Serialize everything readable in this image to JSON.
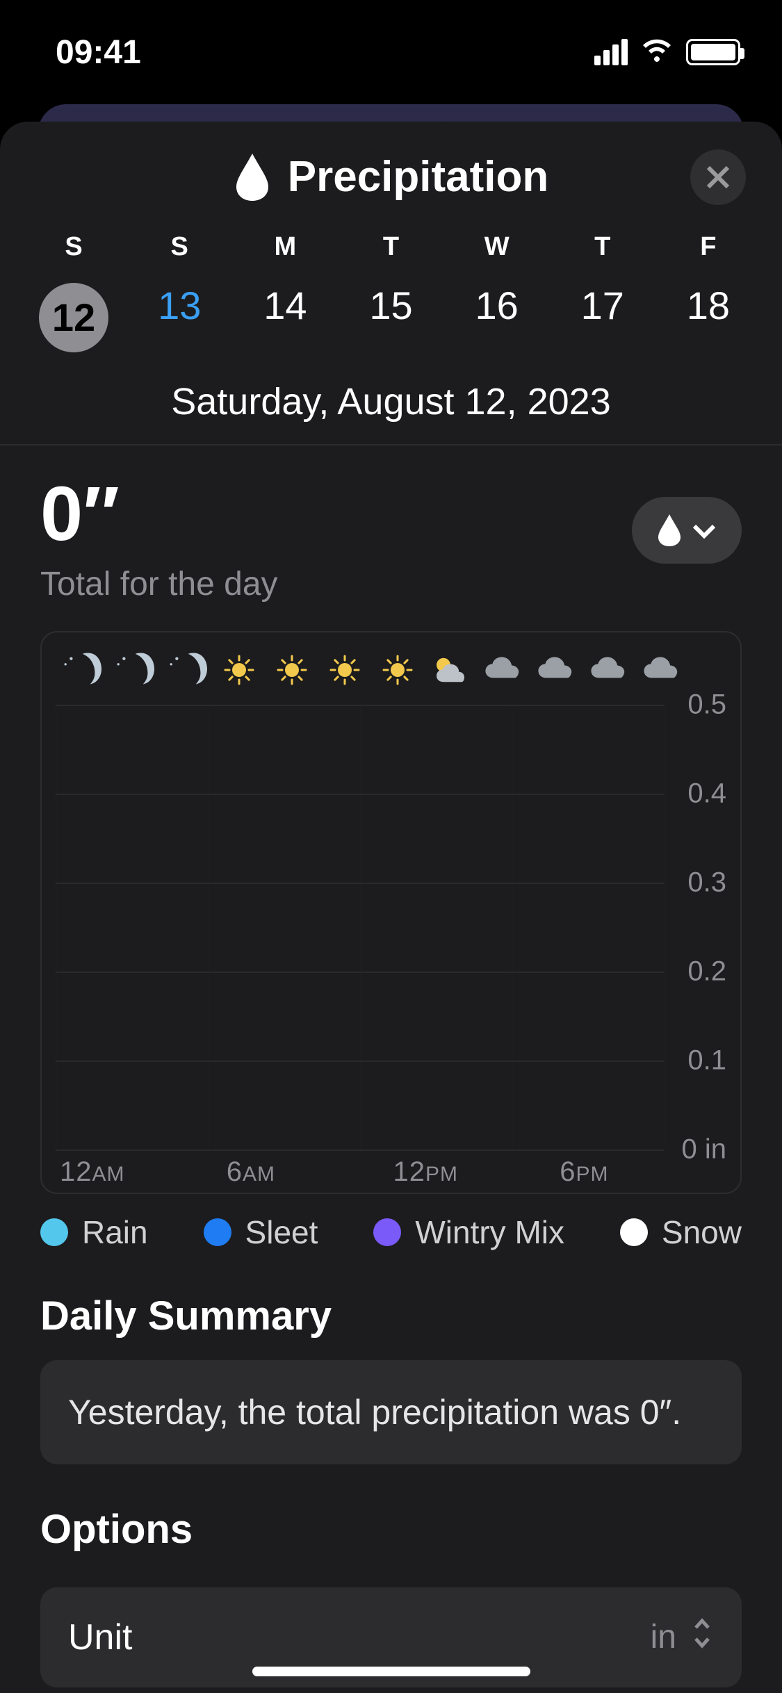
{
  "status": {
    "time": "09:41"
  },
  "header": {
    "title": "Precipitation"
  },
  "week": {
    "days": [
      {
        "lbl": "S",
        "num": "12",
        "selected": true,
        "today": false
      },
      {
        "lbl": "S",
        "num": "13",
        "selected": false,
        "today": true
      },
      {
        "lbl": "M",
        "num": "14",
        "selected": false,
        "today": false
      },
      {
        "lbl": "T",
        "num": "15",
        "selected": false,
        "today": false
      },
      {
        "lbl": "W",
        "num": "16",
        "selected": false,
        "today": false
      },
      {
        "lbl": "T",
        "num": "17",
        "selected": false,
        "today": false
      },
      {
        "lbl": "F",
        "num": "18",
        "selected": false,
        "today": false
      }
    ],
    "full_date": "Saturday, August 12, 2023"
  },
  "total": {
    "value": "0″",
    "subtitle": "Total for the day"
  },
  "chart_data": {
    "type": "bar",
    "title": "Hourly precipitation",
    "ylabel": "in",
    "ylim": [
      0,
      0.5
    ],
    "yticks": [
      "0.5",
      "0.4",
      "0.3",
      "0.2",
      "0.1",
      "0 in"
    ],
    "xticks": [
      "12AM",
      "6AM",
      "12PM",
      "6PM"
    ],
    "hourly_conditions": [
      "clear-night",
      "clear-night",
      "clear-night",
      "sunny",
      "sunny",
      "sunny",
      "sunny",
      "partly-cloudy",
      "cloudy",
      "cloudy",
      "cloudy",
      "cloudy"
    ],
    "series": [
      {
        "name": "Rain",
        "color": "#54c7ec",
        "values": [
          0,
          0,
          0,
          0,
          0,
          0,
          0,
          0,
          0,
          0,
          0,
          0
        ]
      },
      {
        "name": "Sleet",
        "color": "#1f7cf2",
        "values": [
          0,
          0,
          0,
          0,
          0,
          0,
          0,
          0,
          0,
          0,
          0,
          0
        ]
      },
      {
        "name": "Wintry Mix",
        "color": "#7a5af8",
        "values": [
          0,
          0,
          0,
          0,
          0,
          0,
          0,
          0,
          0,
          0,
          0,
          0
        ]
      },
      {
        "name": "Snow",
        "color": "#ffffff",
        "values": [
          0,
          0,
          0,
          0,
          0,
          0,
          0,
          0,
          0,
          0,
          0,
          0
        ]
      }
    ]
  },
  "legend": [
    {
      "label": "Rain",
      "color": "#54c7ec"
    },
    {
      "label": "Sleet",
      "color": "#1f7cf2"
    },
    {
      "label": "Wintry Mix",
      "color": "#7a5af8"
    },
    {
      "label": "Snow",
      "color": "#ffffff"
    }
  ],
  "sections": {
    "daily_summary_title": "Daily Summary",
    "daily_summary_text": "Yesterday, the total precipitation was 0″.",
    "options_title": "Options",
    "unit_label": "Unit",
    "unit_value": "in"
  }
}
